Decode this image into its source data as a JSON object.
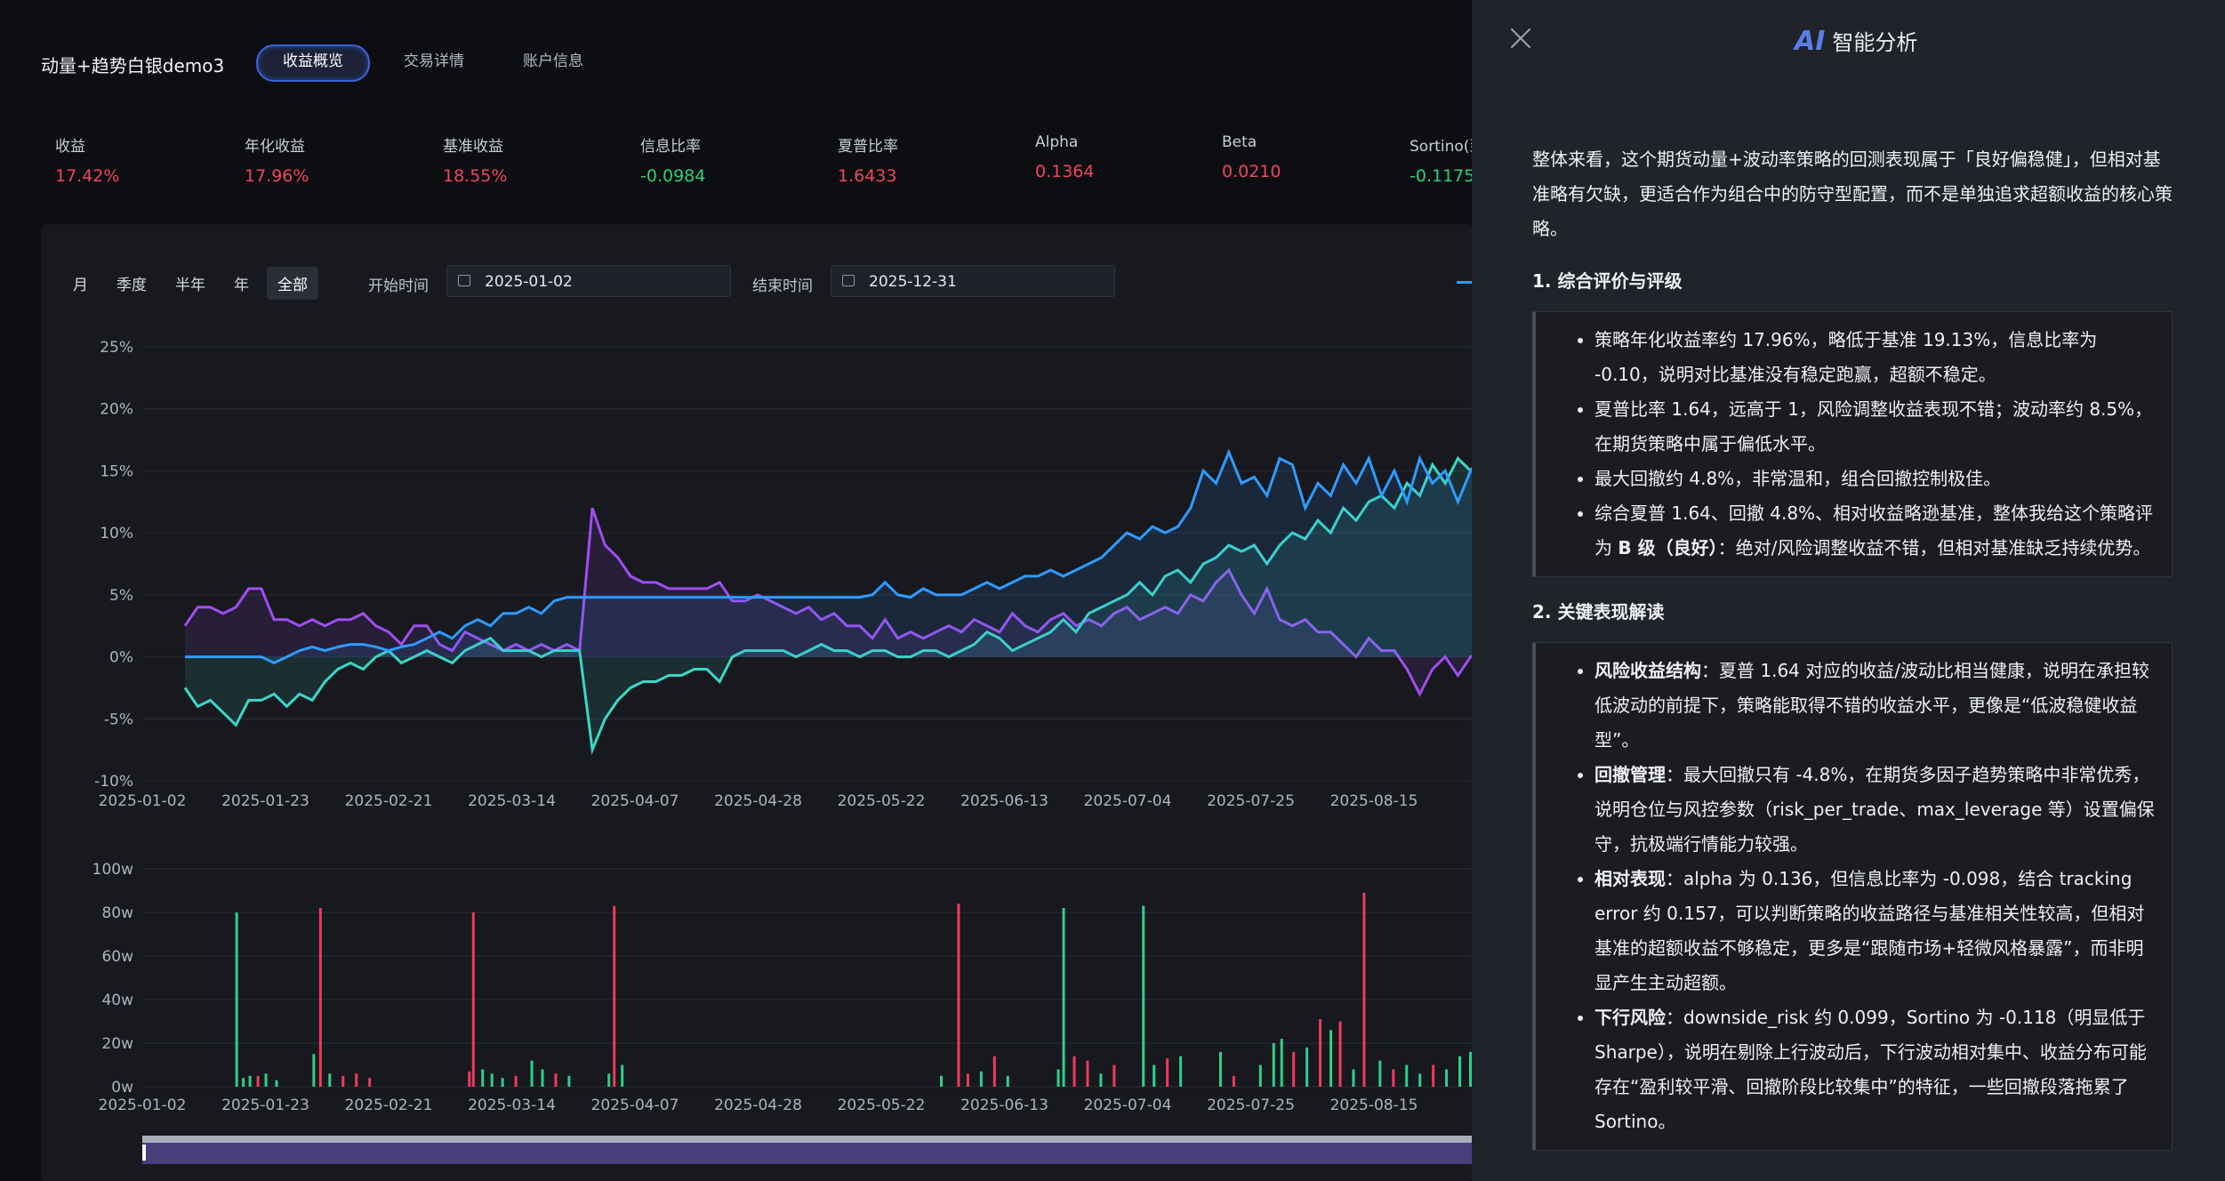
{
  "app": {
    "title": "动量+趋势白银demo3",
    "tabs": [
      "收益概览",
      "交易详情",
      "账户信息"
    ],
    "active_tab": 0
  },
  "metrics": [
    {
      "label": "收益",
      "value": "17.42%",
      "color": "#f0455f"
    },
    {
      "label": "年化收益",
      "value": "17.96%",
      "color": "#f0455f"
    },
    {
      "label": "基准收益",
      "value": "18.55%",
      "color": "#f0455f"
    },
    {
      "label": "信息比率",
      "value": "-0.0984",
      "color": "#2fcf7a"
    },
    {
      "label": "夏普比率",
      "value": "1.6433",
      "color": "#f0455f"
    },
    {
      "label": "Alpha",
      "value": "0.1364",
      "color": "#f0455f"
    },
    {
      "label": "Beta",
      "value": "0.0210",
      "color": "#f0455f"
    },
    {
      "label": "Sortino(到",
      "value": "-0.1175",
      "color": "#2fcf7a"
    }
  ],
  "filters": {
    "periods": [
      "月",
      "季度",
      "半年",
      "年",
      "全部"
    ],
    "active_period": 4,
    "start_label": "开始时间",
    "start_date": "2025-01-02",
    "end_label": "结束时间",
    "end_date": "2025-12-31"
  },
  "chart_data": [
    {
      "type": "line",
      "x_ticks": [
        "2025-01-02",
        "2025-01-23",
        "2025-02-21",
        "2025-03-14",
        "2025-04-07",
        "2025-04-28",
        "2025-05-22",
        "2025-06-13",
        "2025-07-04",
        "2025-07-25",
        "2025-08-15",
        "202"
      ],
      "y_ticks": [
        "25%",
        "20%",
        "15%",
        "10%",
        "5%",
        "0%",
        "-5%",
        "-10%"
      ],
      "ylim": [
        -10,
        25
      ],
      "series": [
        {
          "color": "#2f9bff",
          "values": [
            0,
            0,
            0,
            0,
            0,
            0,
            0,
            -0.5,
            0,
            0.5,
            0.8,
            0.5,
            0.8,
            1,
            1,
            0.8,
            0.5,
            0.8,
            1,
            1.5,
            2,
            1.5,
            2.5,
            3,
            2.5,
            3.5,
            3.5,
            4,
            3.5,
            4.5,
            4.8,
            4.8,
            4.8,
            4.8,
            4.8,
            4.8,
            4.8,
            4.8,
            4.8,
            4.8,
            4.8,
            4.8,
            4.8,
            4.8,
            4.8,
            4.8,
            4.8,
            4.8,
            4.8,
            4.8,
            4.8,
            4.8,
            4.8,
            4.8,
            5,
            6,
            5,
            4.8,
            5.5,
            5,
            5,
            5,
            5.5,
            6,
            5.5,
            6,
            6.5,
            6.5,
            7,
            6.5,
            7,
            7.5,
            8,
            9,
            10,
            9.5,
            10.5,
            10,
            10.5,
            12,
            15,
            14,
            16.5,
            14,
            14.5,
            13,
            16,
            15.5,
            12,
            14,
            13,
            15.5,
            14,
            16,
            13,
            15,
            12.5,
            16,
            14,
            15,
            12.5,
            15,
            14.5,
            16.5,
            14.5,
            17
          ]
        },
        {
          "color": "#3dd6c6",
          "values": [
            -2.5,
            -4,
            -3.5,
            -4.5,
            -5.5,
            -3.5,
            -3.5,
            -3,
            -4,
            -3,
            -3.5,
            -2,
            -1,
            -0.5,
            -1,
            0,
            0.5,
            -0.5,
            0,
            0.5,
            0,
            -0.5,
            0.5,
            1,
            1.5,
            0.5,
            0.5,
            0.5,
            0,
            0.5,
            0.5,
            0.5,
            -7.5,
            -5,
            -3.5,
            -2.5,
            -2,
            -2,
            -1.5,
            -1.5,
            -1,
            -1,
            -2,
            0,
            0.5,
            0.5,
            0.5,
            0.5,
            0,
            0.5,
            1,
            0.5,
            0.5,
            0,
            0.5,
            0.5,
            0,
            0,
            0.5,
            0.5,
            0,
            0.5,
            1,
            2,
            1.5,
            0.5,
            1,
            1.5,
            2,
            3,
            2,
            3.5,
            4,
            4.5,
            5,
            6,
            5,
            6.5,
            7,
            6,
            7.5,
            8,
            9,
            8.5,
            9,
            7.5,
            9,
            10,
            9.5,
            11,
            10,
            12,
            11,
            12.5,
            13,
            12,
            14,
            13,
            15.5,
            14,
            16,
            15,
            16.5,
            15.5
          ]
        },
        {
          "color": "#a04ef0",
          "values": [
            2.5,
            4,
            4,
            3.5,
            4,
            5.5,
            5.5,
            3,
            3,
            2.5,
            3,
            2.5,
            3,
            3,
            3.5,
            2.5,
            2,
            1,
            2.5,
            2.5,
            1,
            0.5,
            2,
            1.5,
            1,
            0.5,
            1,
            0.5,
            1,
            0.5,
            1,
            0.5,
            12,
            9,
            8,
            6.5,
            6,
            6,
            5.5,
            5.5,
            5.5,
            5.5,
            6,
            4.5,
            4.5,
            5,
            4.5,
            4,
            3.5,
            4,
            3,
            3.5,
            2.5,
            2.5,
            1.5,
            3,
            1.5,
            2,
            1.5,
            2,
            2.5,
            2,
            3,
            2.5,
            2,
            3.5,
            2.5,
            2,
            3,
            3.5,
            2.5,
            3,
            2.5,
            3.5,
            4,
            3,
            3.5,
            4,
            3.5,
            5,
            4.5,
            6,
            7,
            5,
            3.5,
            5.5,
            3,
            2.5,
            3,
            2,
            2,
            1,
            0,
            1.5,
            0.5,
            0.5,
            -1,
            -3,
            -1,
            0,
            -1.5,
            0,
            0.5,
            -0.5,
            0
          ]
        }
      ]
    },
    {
      "type": "bar",
      "x_ticks": [
        "2025-01-02",
        "2025-01-23",
        "2025-02-21",
        "2025-03-14",
        "2025-04-07",
        "2025-04-28",
        "2025-05-22",
        "2025-06-13",
        "2025-07-04",
        "2025-07-25",
        "2025-08-15",
        "202"
      ],
      "y_ticks": [
        "100w",
        "80w",
        "60w",
        "40w",
        "20w",
        "0w"
      ],
      "ylim": [
        0,
        100
      ],
      "bars": [
        {
          "x": 0.07,
          "v": 80,
          "c": "g"
        },
        {
          "x": 0.075,
          "v": 4,
          "c": "g"
        },
        {
          "x": 0.08,
          "v": 5,
          "c": "g"
        },
        {
          "x": 0.086,
          "v": 5,
          "c": "r"
        },
        {
          "x": 0.092,
          "v": 6,
          "c": "g"
        },
        {
          "x": 0.1,
          "v": 3,
          "c": "g"
        },
        {
          "x": 0.128,
          "v": 15,
          "c": "g"
        },
        {
          "x": 0.133,
          "v": 82,
          "c": "r"
        },
        {
          "x": 0.14,
          "v": 6,
          "c": "g"
        },
        {
          "x": 0.15,
          "v": 5,
          "c": "r"
        },
        {
          "x": 0.16,
          "v": 6,
          "c": "r"
        },
        {
          "x": 0.17,
          "v": 4,
          "c": "r"
        },
        {
          "x": 0.245,
          "v": 7,
          "c": "r"
        },
        {
          "x": 0.248,
          "v": 80,
          "c": "r"
        },
        {
          "x": 0.255,
          "v": 8,
          "c": "g"
        },
        {
          "x": 0.262,
          "v": 6,
          "c": "g"
        },
        {
          "x": 0.27,
          "v": 4,
          "c": "g"
        },
        {
          "x": 0.28,
          "v": 5,
          "c": "r"
        },
        {
          "x": 0.292,
          "v": 12,
          "c": "g"
        },
        {
          "x": 0.3,
          "v": 8,
          "c": "g"
        },
        {
          "x": 0.31,
          "v": 6,
          "c": "r"
        },
        {
          "x": 0.32,
          "v": 5,
          "c": "g"
        },
        {
          "x": 0.35,
          "v": 6,
          "c": "g"
        },
        {
          "x": 0.354,
          "v": 83,
          "c": "r"
        },
        {
          "x": 0.36,
          "v": 10,
          "c": "g"
        },
        {
          "x": 0.6,
          "v": 5,
          "c": "g"
        },
        {
          "x": 0.613,
          "v": 84,
          "c": "r"
        },
        {
          "x": 0.62,
          "v": 6,
          "c": "r"
        },
        {
          "x": 0.63,
          "v": 7,
          "c": "g"
        },
        {
          "x": 0.64,
          "v": 14,
          "c": "r"
        },
        {
          "x": 0.65,
          "v": 5,
          "c": "g"
        },
        {
          "x": 0.688,
          "v": 8,
          "c": "g"
        },
        {
          "x": 0.692,
          "v": 82,
          "c": "g"
        },
        {
          "x": 0.7,
          "v": 14,
          "c": "r"
        },
        {
          "x": 0.71,
          "v": 12,
          "c": "r"
        },
        {
          "x": 0.72,
          "v": 6,
          "c": "g"
        },
        {
          "x": 0.73,
          "v": 10,
          "c": "r"
        },
        {
          "x": 0.752,
          "v": 83,
          "c": "g"
        },
        {
          "x": 0.76,
          "v": 10,
          "c": "g"
        },
        {
          "x": 0.77,
          "v": 13,
          "c": "r"
        },
        {
          "x": 0.78,
          "v": 14,
          "c": "g"
        },
        {
          "x": 0.81,
          "v": 16,
          "c": "g"
        },
        {
          "x": 0.82,
          "v": 5,
          "c": "r"
        },
        {
          "x": 0.84,
          "v": 10,
          "c": "g"
        },
        {
          "x": 0.85,
          "v": 20,
          "c": "g"
        },
        {
          "x": 0.856,
          "v": 22,
          "c": "g"
        },
        {
          "x": 0.865,
          "v": 16,
          "c": "r"
        },
        {
          "x": 0.875,
          "v": 18,
          "c": "g"
        },
        {
          "x": 0.885,
          "v": 31,
          "c": "r"
        },
        {
          "x": 0.893,
          "v": 26,
          "c": "g"
        },
        {
          "x": 0.9,
          "v": 30,
          "c": "r"
        },
        {
          "x": 0.91,
          "v": 8,
          "c": "g"
        },
        {
          "x": 0.918,
          "v": 89,
          "c": "r"
        },
        {
          "x": 0.93,
          "v": 12,
          "c": "g"
        },
        {
          "x": 0.94,
          "v": 8,
          "c": "r"
        },
        {
          "x": 0.95,
          "v": 10,
          "c": "g"
        },
        {
          "x": 0.96,
          "v": 6,
          "c": "g"
        },
        {
          "x": 0.97,
          "v": 10,
          "c": "r"
        },
        {
          "x": 0.98,
          "v": 8,
          "c": "g"
        },
        {
          "x": 0.99,
          "v": 14,
          "c": "g"
        },
        {
          "x": 0.998,
          "v": 16,
          "c": "g"
        }
      ]
    }
  ],
  "ai_panel": {
    "logo": "AI",
    "title": "智能分析",
    "intro": "整体来看，这个期货动量+波动率策略的回测表现属于「良好偏稳健」，但相对基准略有欠缺，更适合作为组合中的防守型配置，而不是单独追求超额收益的核心策略。",
    "section1_title": "1. 综合评价与评级",
    "section1_items": [
      "策略年化收益率约 17.96%，略低于基准 19.13%，信息比率为 -0.10，说明对比基准没有稳定跑赢，超额不稳定。",
      "夏普比率 1.64，远高于 1，风险调整收益表现不错；波动率约 8.5%，在期货策略中属于偏低水平。",
      "最大回撤约 4.8%，非常温和，组合回撤控制极佳。"
    ],
    "section1_last_a": "综合夏普 1.64、回撤 4.8%、相对收益略逊基准，整体我给这个策略评为 ",
    "section1_last_b": "B 级（良好）",
    "section1_last_c": "：绝对/风险调整收益不错，但相对基准缺乏持续优势。",
    "section2_title": "2. 关键表现解读",
    "section2_items": [
      {
        "head": "风险收益结构",
        "text": "：夏普 1.64 对应的收益/波动比相当健康，说明在承担较低波动的前提下，策略能取得不错的收益水平，更像是“低波稳健收益型”。"
      },
      {
        "head": "回撤管理",
        "text": "：最大回撤只有 -4.8%，在期货多因子趋势策略中非常优秀，说明仓位与风控参数（risk_per_trade、max_leverage 等）设置偏保守，抗极端行情能力较强。"
      },
      {
        "head": "相对表现",
        "text": "：alpha 为 0.136，但信息比率为 -0.098，结合 tracking error 约 0.157，可以判断策略的收益路径与基准相关性较高，但相对基准的超额收益不够稳定，更多是“跟随市场+轻微风格暴露”，而非明显产生主动超额。"
      },
      {
        "head": "下行风险",
        "text": "：downside_risk 约 0.099，Sortino 为 -0.118（明显低于 Sharpe），说明在剔除上行波动后，下行波动相对集中、收益分布可能存在“盈利较平滑、回撤阶段比较集中”的特征，一些回撤段落拖累了 Sortino。"
      }
    ]
  }
}
